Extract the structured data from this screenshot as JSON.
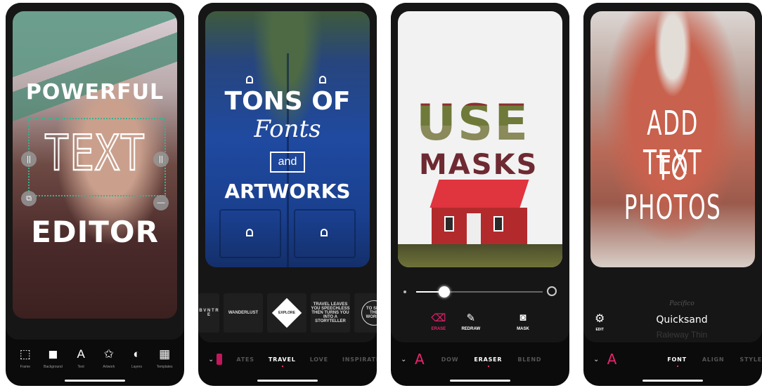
{
  "accent_color": "#e8246f",
  "phones": [
    {
      "headline": {
        "line1": "POWERFUL",
        "line2": "TEXT",
        "line3": "EDITOR"
      },
      "handles": {
        "left": "||",
        "right": "||",
        "bottom_left": "⧉",
        "bottom_right": "—"
      },
      "toolbar": [
        {
          "icon": "frame-icon",
          "glyph": "⬚",
          "label": "Frame"
        },
        {
          "icon": "background-icon",
          "glyph": "◼",
          "label": "Background"
        },
        {
          "icon": "text-icon",
          "glyph": "A",
          "label": "Text"
        },
        {
          "icon": "artwork-icon",
          "glyph": "✩",
          "label": "Artwork"
        },
        {
          "icon": "layers-icon",
          "glyph": "◐",
          "label": "Layers"
        },
        {
          "icon": "templates-icon",
          "glyph": "▦",
          "label": "Templates"
        }
      ]
    },
    {
      "headline": {
        "line1": "TONS OF",
        "line2": "Fonts",
        "line3": "and",
        "line4": "ARTWORKS"
      },
      "artworks": [
        {
          "label": "B V N T R E"
        },
        {
          "label": "WANDERLUST"
        },
        {
          "label": "EXPLORE"
        },
        {
          "label": "TRAVEL LEAVES YOU SPEECHLESS THEN TURNS YOU INTO A STORYTELLER"
        },
        {
          "label": "TO SEE THE WORLD"
        }
      ],
      "tabs": [
        {
          "label": "ATES",
          "active": false
        },
        {
          "label": "TRAVEL",
          "active": true
        },
        {
          "label": "LOVE",
          "active": false
        },
        {
          "label": "INSPIRATI",
          "active": false
        }
      ]
    },
    {
      "headline": {
        "line1": "USE",
        "line2": "MASKS"
      },
      "brush_size": {
        "value_fraction": 0.22
      },
      "tools": [
        {
          "icon": "eraser-icon",
          "glyph": "⌫",
          "label": "ERASE",
          "active": true
        },
        {
          "icon": "pencil-icon",
          "glyph": "✎",
          "label": "REDRAW",
          "active": false
        },
        {
          "icon": "mask-icon",
          "glyph": "◙",
          "label": "MASK",
          "active": false
        }
      ],
      "tabs": [
        {
          "label": "DOW",
          "active": false
        },
        {
          "label": "ERASER",
          "active": true
        },
        {
          "label": "BLEND",
          "active": false
        }
      ]
    },
    {
      "headline": {
        "line1": "ADD TEXT",
        "line2": "TO PHOTOS"
      },
      "edit": {
        "glyph": "⚙",
        "label": "EDIT"
      },
      "fonts": {
        "previous": "Pacifico",
        "current": "Quicksand",
        "next": "Raleway Thin"
      },
      "tabs": [
        {
          "label": "FONT",
          "active": true
        },
        {
          "label": "ALIGN",
          "active": false
        },
        {
          "label": "STYLE",
          "active": false
        }
      ]
    }
  ]
}
